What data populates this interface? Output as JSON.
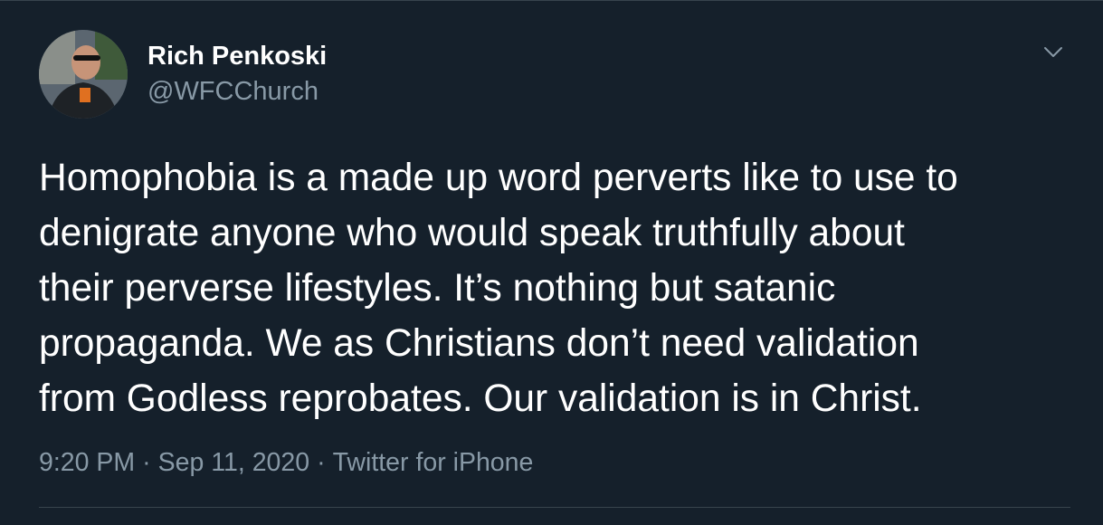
{
  "tweet": {
    "author_name": "Rich Penkoski",
    "author_handle": "@WFCChurch",
    "avatar_icon": "user-avatar",
    "menu_icon": "chevron-down-icon",
    "text": "Homophobia is a made up word perverts like to use to\ndenigrate anyone who would speak truthfully about\ntheir perverse lifestyles. It’s nothing but satanic\npropaganda. We as Christians don’t need validation\nfrom Godless reprobates. Our validation is in Christ.",
    "time": "9:20 PM",
    "date": "Sep 11, 2020",
    "source": "Twitter for iPhone",
    "separator": "·"
  },
  "colors": {
    "background": "#15202b",
    "primary_text": "#ffffff",
    "secondary_text": "#8899a6",
    "border": "#38444d"
  }
}
